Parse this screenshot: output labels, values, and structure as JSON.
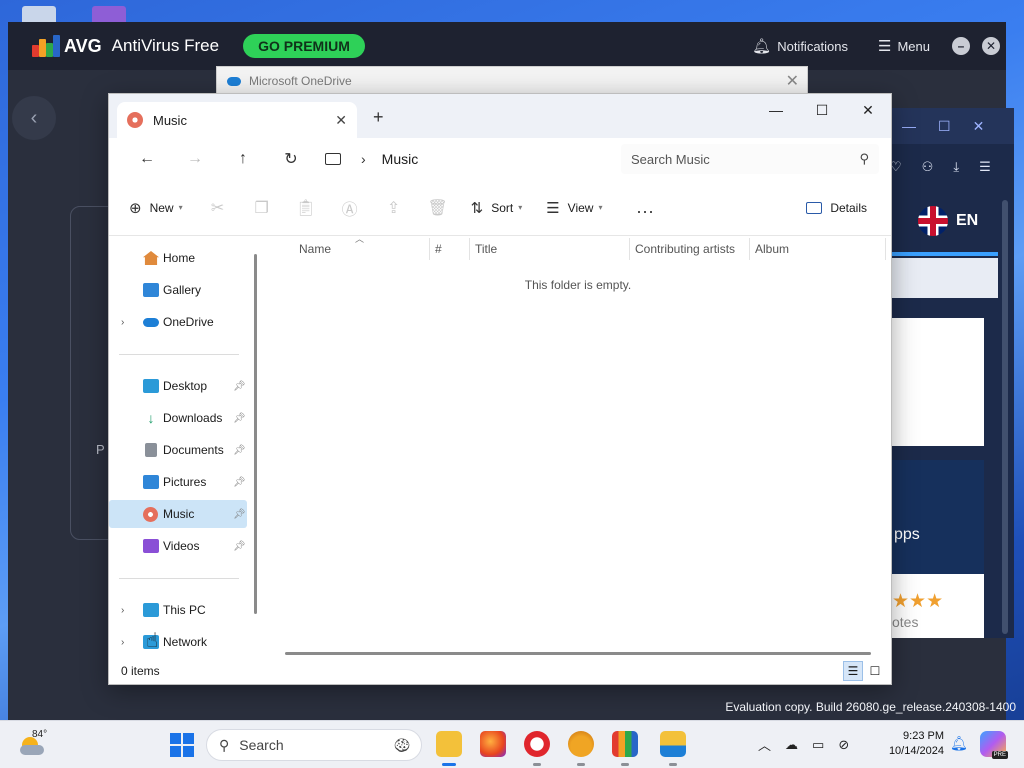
{
  "avg": {
    "brand": "AVG",
    "product": "AntiVirus Free",
    "premium_label": "GO PREMIUM",
    "notifications_label": "Notifications",
    "menu_label": "Menu",
    "back_icon": "chevron-left-icon",
    "card_letter": "P"
  },
  "onedrive": {
    "title": "Microsoft OneDrive"
  },
  "browser": {
    "language": "EN",
    "panel_text": "pps",
    "stars": "★★★",
    "votes": "otes"
  },
  "explorer": {
    "tab_label": "Music",
    "address": {
      "current": "Music"
    },
    "search": {
      "placeholder": "Search Music"
    },
    "commands": {
      "new": "New",
      "sort": "Sort",
      "view": "View",
      "more": "...",
      "details": "Details"
    },
    "sidebar": {
      "items": [
        {
          "label": "Home",
          "icon": "home-icon",
          "color": "#e08a3c"
        },
        {
          "label": "Gallery",
          "icon": "gallery-icon",
          "color": "#2f86d8"
        },
        {
          "label": "OneDrive",
          "icon": "onedrive-icon",
          "color": "#1d7fd6"
        },
        {
          "label": "Desktop",
          "icon": "desktop-icon",
          "color": "#2b9ad8"
        },
        {
          "label": "Downloads",
          "icon": "downloads-icon",
          "color": "#1e9e6a"
        },
        {
          "label": "Documents",
          "icon": "documents-icon",
          "color": "#8a9099"
        },
        {
          "label": "Pictures",
          "icon": "pictures-icon",
          "color": "#2f86d8"
        },
        {
          "label": "Music",
          "icon": "music-icon",
          "color": "#e56f5c"
        },
        {
          "label": "Videos",
          "icon": "videos-icon",
          "color": "#8a4fd6"
        },
        {
          "label": "This PC",
          "icon": "this-pc-icon",
          "color": "#2b9ad8"
        },
        {
          "label": "Network",
          "icon": "network-icon",
          "color": "#2b9ad8"
        }
      ]
    },
    "columns": [
      "Name",
      "#",
      "Title",
      "Contributing artists",
      "Album"
    ],
    "empty_message": "This folder is empty.",
    "status": "0 items"
  },
  "watermark": "Evaluation copy. Build 26080.ge_release.240308-1400",
  "taskbar": {
    "weather_temp": "84°",
    "search_label": "Search",
    "time": "9:23 PM",
    "date": "10/14/2024",
    "copilot_badge": "PRE"
  }
}
